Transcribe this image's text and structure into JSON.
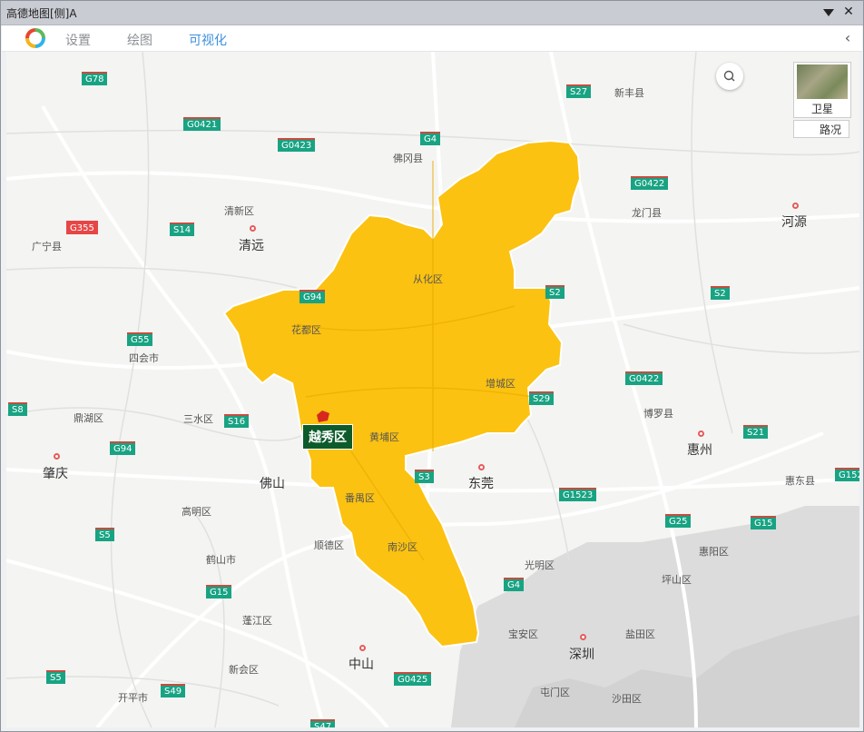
{
  "window": {
    "title": "高德地图[侧]A"
  },
  "toolbar": {
    "tabs": [
      {
        "label": "设置",
        "active": false
      },
      {
        "label": "绘图",
        "active": false
      },
      {
        "label": "可视化",
        "active": true
      }
    ],
    "accent_color": "#3d8fe0"
  },
  "map": {
    "highlight_color": "#fcc211",
    "selected_region": "越秀区",
    "controls": {
      "satellite_label": "卫星",
      "traffic_label": "路况"
    },
    "cities": [
      "清远",
      "河源",
      "肇庆",
      "佛山",
      "东莞",
      "惠州",
      "中山",
      "深圳"
    ],
    "places": [
      "新丰县",
      "佛冈县",
      "龙门县",
      "清新区",
      "广宁县",
      "四会市",
      "鼎湖区",
      "三水区",
      "高明区",
      "鹤山市",
      "顺德区",
      "蓬江区",
      "新会区",
      "开平市",
      "博罗县",
      "惠东县",
      "惠阳区",
      "坪山区",
      "光明区",
      "宝安区",
      "盐田区",
      "屯门区",
      "沙田区",
      "花都区",
      "从化区",
      "增城区",
      "黄埔区",
      "番禺区",
      "南沙区"
    ],
    "roads": [
      "G78",
      "G0421",
      "G0423",
      "G4",
      "S27",
      "G0422",
      "G355",
      "S14",
      "S2",
      "S2",
      "G55",
      "G94",
      "S8",
      "S16",
      "G94",
      "G0422",
      "S29",
      "S21",
      "S3",
      "G1523",
      "G152",
      "G25",
      "G15",
      "S5",
      "G4",
      "G15",
      "S5",
      "S49",
      "G0425",
      "S47"
    ]
  }
}
